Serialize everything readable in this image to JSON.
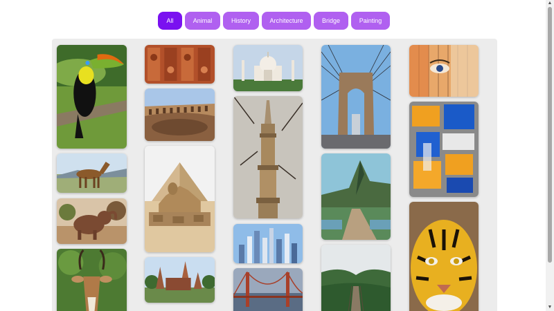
{
  "filters": [
    {
      "label": "All",
      "active": true
    },
    {
      "label": "Animal",
      "active": false
    },
    {
      "label": "History",
      "active": false
    },
    {
      "label": "Architecture",
      "active": false
    },
    {
      "label": "Bridge",
      "active": false
    },
    {
      "label": "Painting",
      "active": false
    }
  ],
  "photos": [
    {
      "name": "toucan-photo",
      "subject": "toucan",
      "category": "Animal"
    },
    {
      "name": "horse-photo",
      "subject": "horse",
      "category": "Animal"
    },
    {
      "name": "elephant-photo",
      "subject": "elephant",
      "category": "Animal"
    },
    {
      "name": "antelope-photo",
      "subject": "antelope",
      "category": "Animal"
    },
    {
      "name": "carved-wall-photo",
      "subject": "carved relief wall",
      "category": "History"
    },
    {
      "name": "colosseum-photo",
      "subject": "colosseum",
      "category": "History"
    },
    {
      "name": "sphinx-pyramid-photo",
      "subject": "sphinx and pyramid",
      "category": "History"
    },
    {
      "name": "temple-photo",
      "subject": "temple",
      "category": "History"
    },
    {
      "name": "taj-mahal-photo",
      "subject": "taj mahal",
      "category": "Architecture"
    },
    {
      "name": "minaret-photo",
      "subject": "minaret",
      "category": "Architecture"
    },
    {
      "name": "skyscrapers-photo",
      "subject": "skyscrapers",
      "category": "Architecture"
    },
    {
      "name": "golden-gate-photo",
      "subject": "golden gate bridge",
      "category": "Bridge"
    },
    {
      "name": "brooklyn-bridge-photo",
      "subject": "brooklyn bridge",
      "category": "Bridge"
    },
    {
      "name": "mountain-boardwalk-photo",
      "subject": "mountain boardwalk",
      "category": "Bridge"
    },
    {
      "name": "suspension-footbridge-photo",
      "subject": "suspension footbridge",
      "category": "Bridge"
    },
    {
      "name": "eye-mural-photo",
      "subject": "eye mural",
      "category": "Painting"
    },
    {
      "name": "abstract-painting-photo",
      "subject": "abstract blue orange painting",
      "category": "Painting"
    },
    {
      "name": "tiger-painting-photo",
      "subject": "tiger painting",
      "category": "Painting"
    }
  ]
}
